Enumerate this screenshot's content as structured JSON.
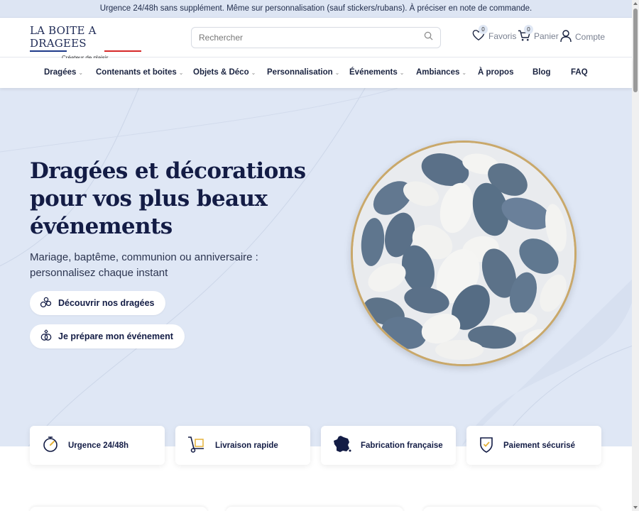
{
  "topbar": {
    "text": "Urgence 24/48h sans supplément. Même sur personnalisation (sauf stickers/rubans). À préciser en note de commande."
  },
  "header": {
    "logo_title": "LA BOITE A DRAGEES",
    "logo_subtitle": "Créateur de plaisir",
    "search_placeholder": "Rechercher",
    "favorites": {
      "label": "Favoris",
      "count": "0",
      "icon": "heart-icon"
    },
    "cart": {
      "label": "Panier",
      "count": "0",
      "icon": "cart-icon"
    },
    "account": {
      "label": "Compte",
      "icon": "user-icon"
    }
  },
  "nav": {
    "items": [
      {
        "label": "Dragées",
        "has_menu": true
      },
      {
        "label": "Contenants et boites",
        "has_menu": true
      },
      {
        "label": "Objets & Déco",
        "has_menu": true
      },
      {
        "label": "Personnalisation",
        "has_menu": true
      },
      {
        "label": "Événements",
        "has_menu": true
      },
      {
        "label": "Ambiances",
        "has_menu": true
      },
      {
        "label": "À propos",
        "has_menu": false
      },
      {
        "label": "Blog",
        "has_menu": false
      },
      {
        "label": "FAQ",
        "has_menu": false
      }
    ]
  },
  "hero": {
    "title": "Dragées et décorations pour vos plus beaux événements",
    "subtitle": "Mariage, baptême, communion ou anniversaire : personnalisez chaque instant",
    "cta_primary": "Découvrir nos dragées",
    "cta_secondary": "Je prépare mon événement"
  },
  "features": [
    {
      "label": "Urgence 24/48h",
      "icon": "stopwatch-icon"
    },
    {
      "label": "Livraison rapide",
      "icon": "hand-truck-icon"
    },
    {
      "label": "Fabrication française",
      "icon": "france-map-icon"
    },
    {
      "label": "Paiement sécurisé",
      "icon": "shield-check-icon"
    }
  ],
  "colors": {
    "navy": "#131c45",
    "hero_bg": "#dfe7f5",
    "topbar_bg": "#dde5f3",
    "flag_blue": "#1e3a8a",
    "flag_red": "#d62828",
    "gold": "#c9a86a",
    "accent_gold": "#e5b23a"
  }
}
